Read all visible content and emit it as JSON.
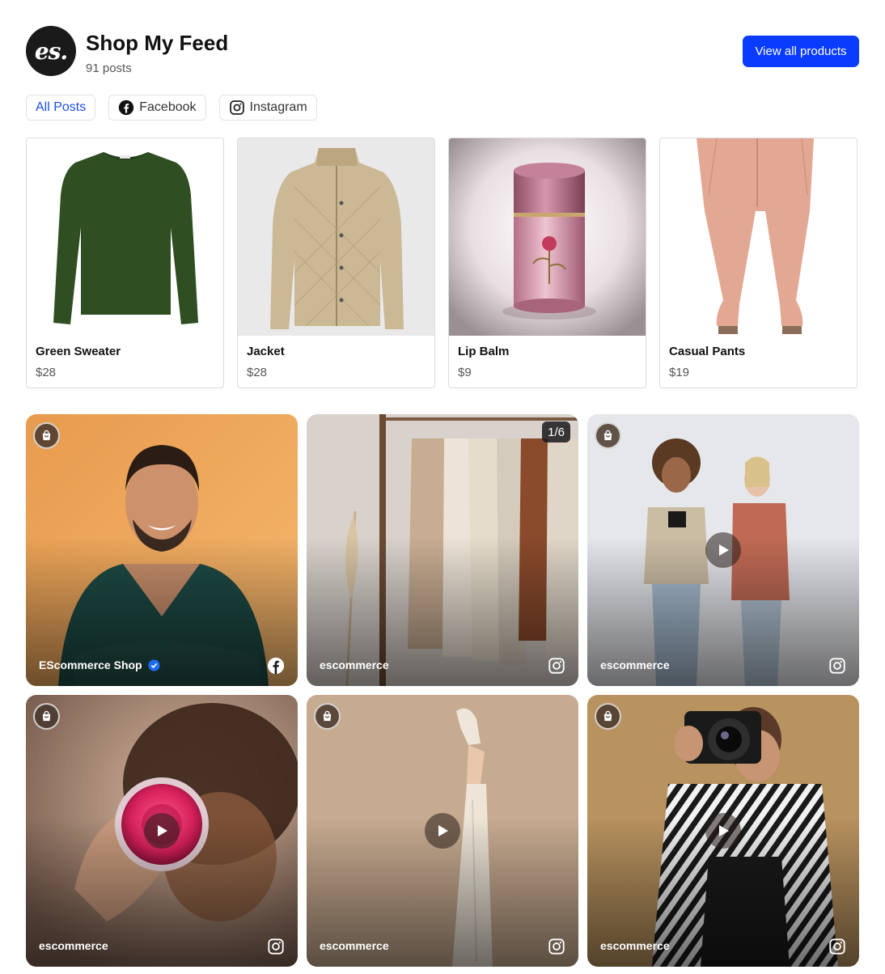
{
  "header": {
    "logo_text": "es.",
    "title": "Shop My Feed",
    "post_count": "91 posts",
    "view_all_label": "View all products"
  },
  "tabs": [
    {
      "label": "All Posts",
      "icon": "none",
      "active": true
    },
    {
      "label": "Facebook",
      "icon": "facebook-icon",
      "active": false
    },
    {
      "label": "Instagram",
      "icon": "instagram-icon",
      "active": false
    }
  ],
  "products": [
    {
      "name": "Green Sweater",
      "price": "$28",
      "image": "green-sweater-image"
    },
    {
      "name": "Jacket",
      "price": "$28",
      "image": "quilted-jacket-image"
    },
    {
      "name": "Lip Balm",
      "price": "$9",
      "image": "lip-balm-image"
    },
    {
      "name": "Casual Pants",
      "price": "$19",
      "image": "casual-pants-image"
    }
  ],
  "posts": [
    {
      "author": "EScommerce Shop",
      "verified": true,
      "network": "facebook-icon",
      "shop_badge": true,
      "media": "image"
    },
    {
      "author": "escommerce",
      "verified": false,
      "network": "instagram-icon",
      "shop_badge": false,
      "carousel": "1/6",
      "media": "carousel"
    },
    {
      "author": "escommerce",
      "verified": false,
      "network": "instagram-icon",
      "shop_badge": true,
      "media": "video"
    },
    {
      "author": "escommerce",
      "verified": false,
      "network": "instagram-icon",
      "shop_badge": true,
      "media": "video"
    },
    {
      "author": "escommerce",
      "verified": false,
      "network": "instagram-icon",
      "shop_badge": true,
      "media": "video"
    },
    {
      "author": "escommerce",
      "verified": false,
      "network": "instagram-icon",
      "shop_badge": true,
      "media": "video"
    }
  ],
  "colors": {
    "accent": "#0a3cff",
    "active_tab": "#1d4fe6",
    "verified": "#1d6cf5"
  }
}
